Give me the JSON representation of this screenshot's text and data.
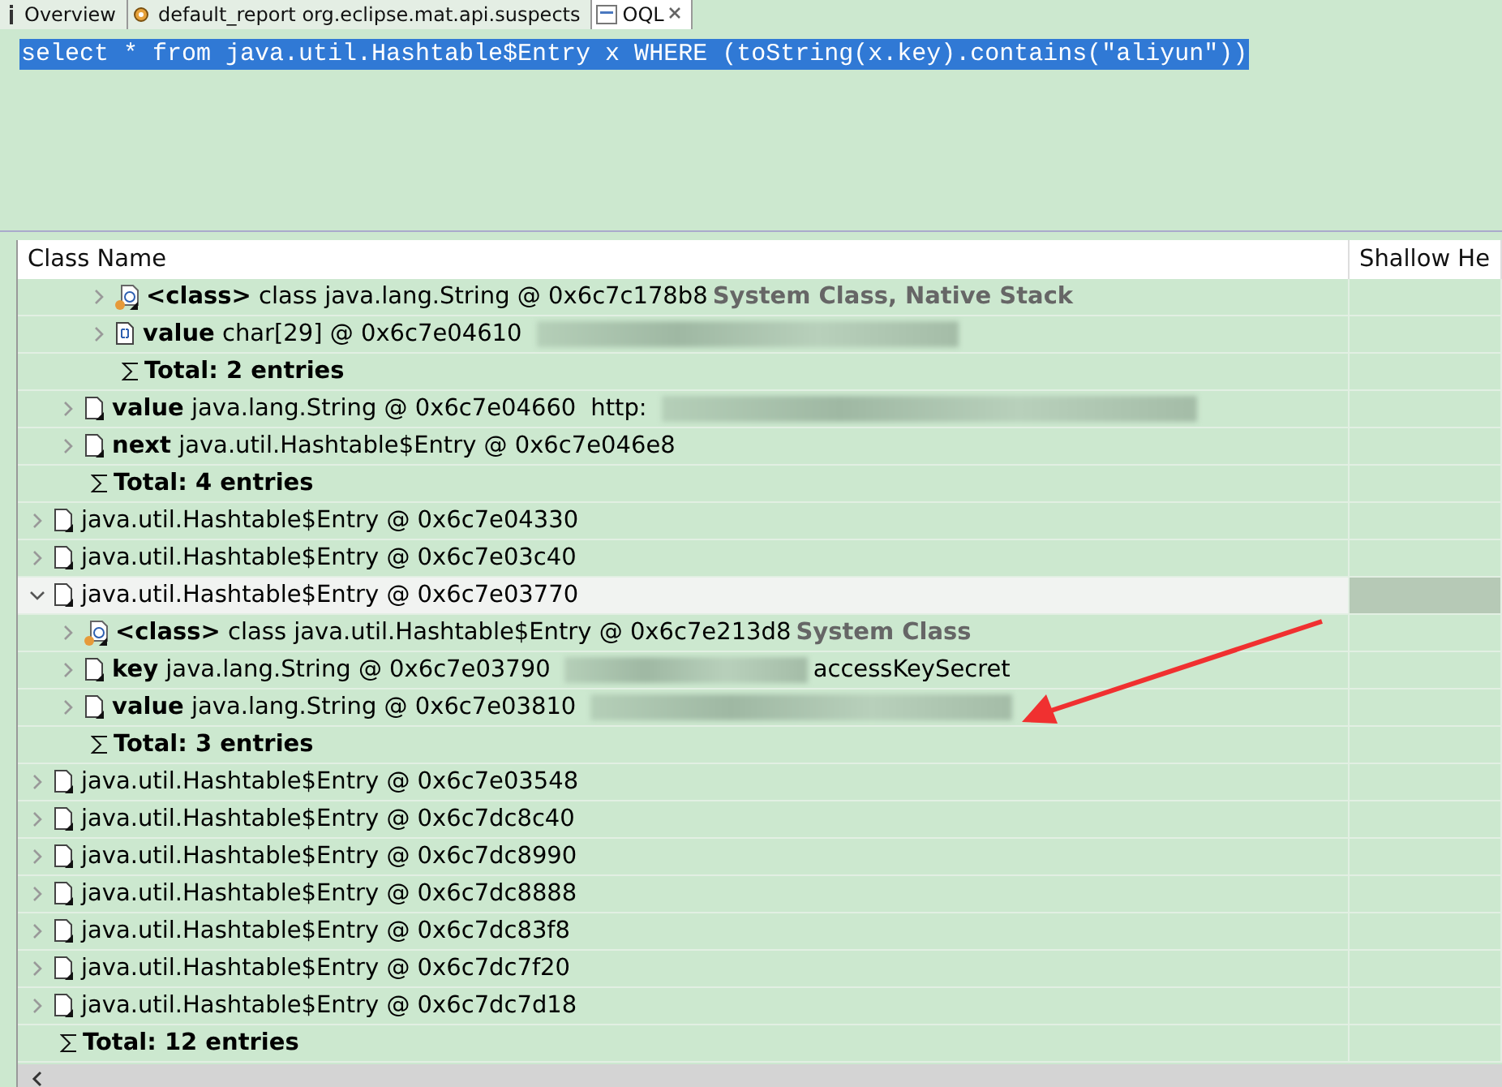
{
  "tabs": [
    {
      "label": "Overview",
      "kind": "info",
      "selected": false
    },
    {
      "label": "default_report  org.eclipse.mat.api.suspects",
      "kind": "report",
      "selected": false
    },
    {
      "label": "OQL",
      "kind": "oql",
      "selected": true,
      "closable": true
    }
  ],
  "query": {
    "text": "select * from java.util.Hashtable$Entry x WHERE (toString(x.key).contains(\"aliyun\"))",
    "selected": true
  },
  "table": {
    "columns": [
      "Class Name",
      "Shallow He"
    ],
    "tree": [
      {
        "kind": "continued",
        "children": [
          {
            "kind": "continued",
            "children": [
              {
                "kind": "class",
                "selected": false,
                "expanded": false,
                "field": "<class>",
                "text": "class java.lang.String @ 0x6c7c178b8",
                "note": "System Class, Native Stack"
              },
              {
                "kind": "array",
                "selected": false,
                "expanded": false,
                "field": "value",
                "text": "char[29] @ 0x6c7e04610",
                "redacted": true
              },
              {
                "kind": "total",
                "selected": false,
                "text": "Total: 2 entries"
              }
            ]
          },
          {
            "kind": "object",
            "selected": false,
            "expanded": false,
            "field": "value",
            "text": "java.lang.String @ 0x6c7e04660",
            "value_before": "http:",
            "redacted": true
          },
          {
            "kind": "object",
            "selected": false,
            "expanded": false,
            "field": "next",
            "text": "java.util.Hashtable$Entry @ 0x6c7e046e8"
          },
          {
            "kind": "total",
            "selected": false,
            "text": "Total: 4 entries"
          }
        ]
      },
      {
        "kind": "object",
        "selected": false,
        "expanded": false,
        "text": "java.util.Hashtable$Entry @ 0x6c7e04330"
      },
      {
        "kind": "object",
        "selected": false,
        "expanded": false,
        "text": "java.util.Hashtable$Entry @ 0x6c7e03c40"
      },
      {
        "kind": "object",
        "selected": true,
        "expanded": true,
        "text": "java.util.Hashtable$Entry @ 0x6c7e03770",
        "children": [
          {
            "kind": "class",
            "selected": false,
            "expanded": false,
            "field": "<class>",
            "text": "class java.util.Hashtable$Entry @ 0x6c7e213d8",
            "note": "System Class"
          },
          {
            "kind": "object",
            "selected": false,
            "expanded": false,
            "field": "key",
            "text": "java.lang.String @ 0x6c7e03790",
            "redacted": true,
            "value_after": "accessKeySecret"
          },
          {
            "kind": "object",
            "selected": false,
            "expanded": false,
            "field": "value",
            "text": "java.lang.String @ 0x6c7e03810",
            "redacted": true
          },
          {
            "kind": "total",
            "selected": false,
            "text": "Total: 3 entries"
          }
        ]
      },
      {
        "kind": "object",
        "selected": false,
        "expanded": false,
        "text": "java.util.Hashtable$Entry @ 0x6c7e03548"
      },
      {
        "kind": "object",
        "selected": false,
        "expanded": false,
        "text": "java.util.Hashtable$Entry @ 0x6c7dc8c40"
      },
      {
        "kind": "object",
        "selected": false,
        "expanded": false,
        "text": "java.util.Hashtable$Entry @ 0x6c7dc8990"
      },
      {
        "kind": "object",
        "selected": false,
        "expanded": false,
        "text": "java.util.Hashtable$Entry @ 0x6c7dc8888"
      },
      {
        "kind": "object",
        "selected": false,
        "expanded": false,
        "text": "java.util.Hashtable$Entry @ 0x6c7dc83f8"
      },
      {
        "kind": "object",
        "selected": false,
        "expanded": false,
        "text": "java.util.Hashtable$Entry @ 0x6c7dc7f20"
      },
      {
        "kind": "object",
        "selected": false,
        "expanded": false,
        "text": "java.util.Hashtable$Entry @ 0x6c7dc7d18"
      },
      {
        "kind": "total",
        "selected": false,
        "text": "Total: 12 entries"
      }
    ]
  }
}
